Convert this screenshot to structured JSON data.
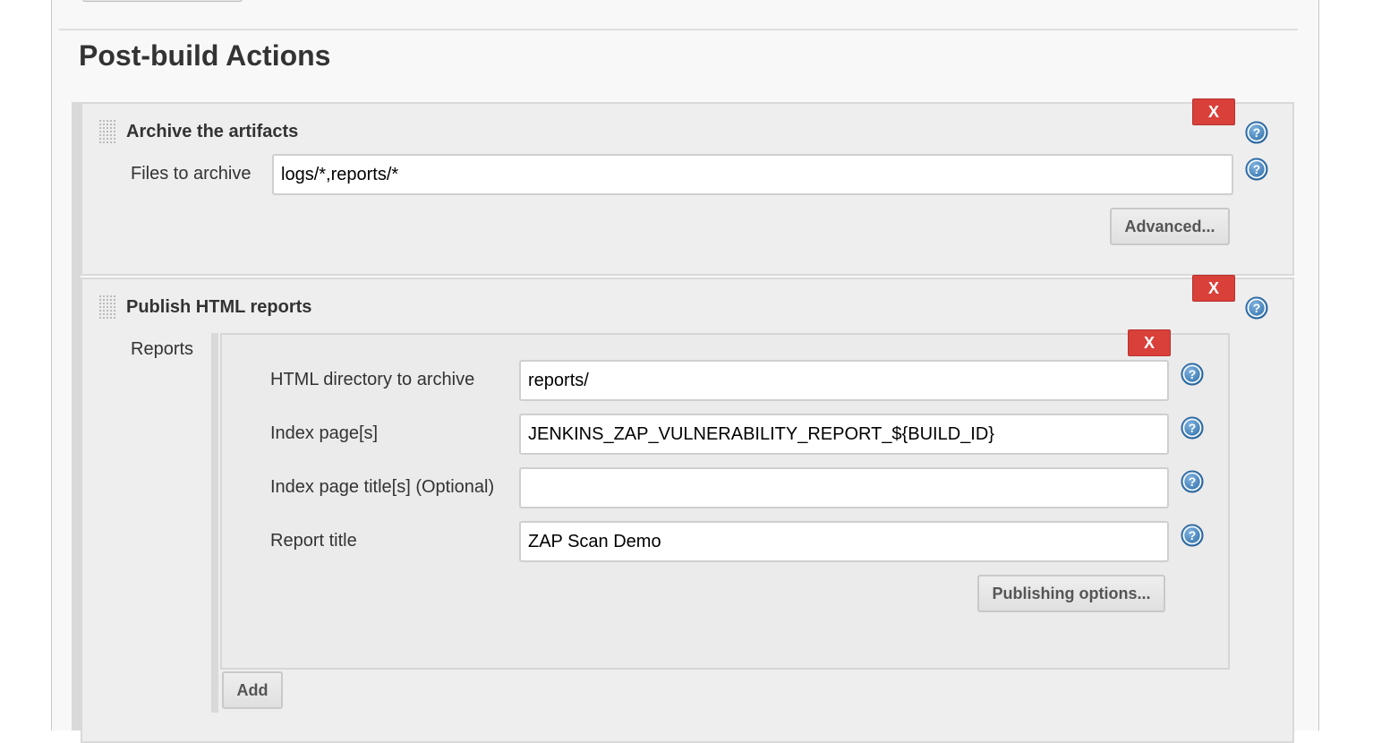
{
  "section": {
    "title": "Post-build Actions"
  },
  "archive_step": {
    "title": "Archive the artifacts",
    "delete_label": "X",
    "files_label": "Files to archive",
    "files_value": "logs/*,reports/*",
    "advanced_label": "Advanced..."
  },
  "publish_step": {
    "title": "Publish HTML reports",
    "delete_label": "X",
    "reports_label": "Reports",
    "report": {
      "delete_label": "X",
      "fields": {
        "html_directory": {
          "label": "HTML directory to archive",
          "value": "reports/"
        },
        "index_pages": {
          "label": "Index page[s]",
          "value": "JENKINS_ZAP_VULNERABILITY_REPORT_${BUILD_ID}"
        },
        "index_titles": {
          "label": "Index page title[s] (Optional)",
          "value": ""
        },
        "report_title": {
          "label": "Report title",
          "value": "ZAP Scan Demo"
        }
      },
      "publishing_options_label": "Publishing options..."
    },
    "add_label": "Add"
  },
  "icons": {
    "help": "help-question-icon",
    "drag": "drag-handle-icon"
  },
  "colors": {
    "delete": "#d9403a",
    "help": "#2f6fa8"
  }
}
